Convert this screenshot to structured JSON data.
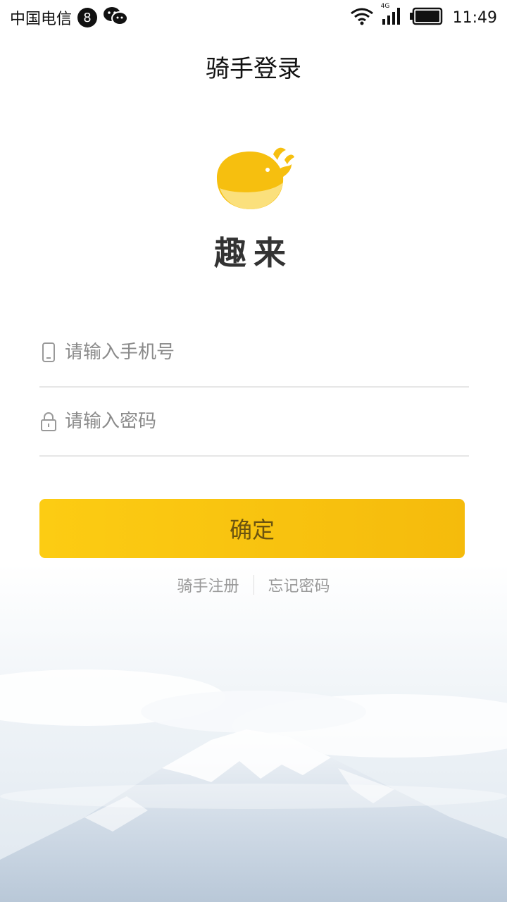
{
  "status_bar": {
    "carrier": "中国电信",
    "badge_count": "8",
    "network": "4G",
    "time": "11:49"
  },
  "page": {
    "title": "骑手登录"
  },
  "brand": {
    "name": "趣来",
    "logo_icon": "whale-icon",
    "colors": {
      "primary": "#f5bf0f",
      "primary_light": "#fde58a"
    }
  },
  "form": {
    "phone_placeholder": "请输入手机号",
    "phone_value": "",
    "password_placeholder": "请输入密码",
    "password_value": ""
  },
  "actions": {
    "confirm_label": "确定",
    "register_label": "骑手注册",
    "forgot_label": "忘记密码"
  }
}
